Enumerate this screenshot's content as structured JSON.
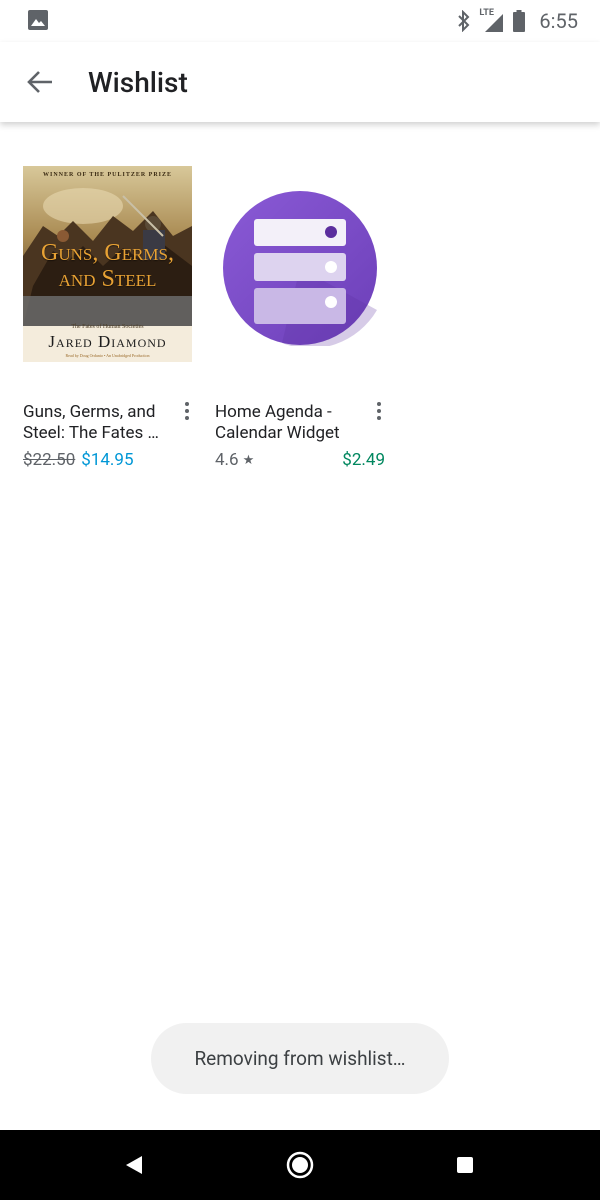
{
  "status_bar": {
    "time": "6:55",
    "network_label": "LTE",
    "icons": [
      "image-notification-icon",
      "bluetooth-icon",
      "signal-icon",
      "battery-icon"
    ]
  },
  "app_bar": {
    "title": "Wishlist",
    "back_icon": "arrow-back-icon"
  },
  "items": [
    {
      "title": "Guns, Germs, and Steel: The Fates …",
      "price_original": "$22.50",
      "price_sale": "$14.95",
      "cover": {
        "top_line": "WINNER OF THE PULITZER PRIZE",
        "title": "Guns, Germs, and Steel",
        "subtitle": "The Fates of Human Societies",
        "author": "Jared Diamond",
        "reader": "Read by Doug Ordunio • An Unabridged Production"
      }
    },
    {
      "title": "Home Agenda - Calendar Widget",
      "rating": "4.6",
      "rating_icon": "star-icon",
      "price": "$2.49",
      "icon_color": "#7e4fc9"
    }
  ],
  "snackbar": {
    "message": "Removing from wishlist…"
  },
  "nav_bar": {
    "icons": [
      "nav-back-icon",
      "nav-home-icon",
      "nav-recents-icon"
    ]
  },
  "colors": {
    "sale_price": "#0097d6",
    "app_price": "#01875f",
    "app_icon_purple": "#7e4fc9"
  }
}
